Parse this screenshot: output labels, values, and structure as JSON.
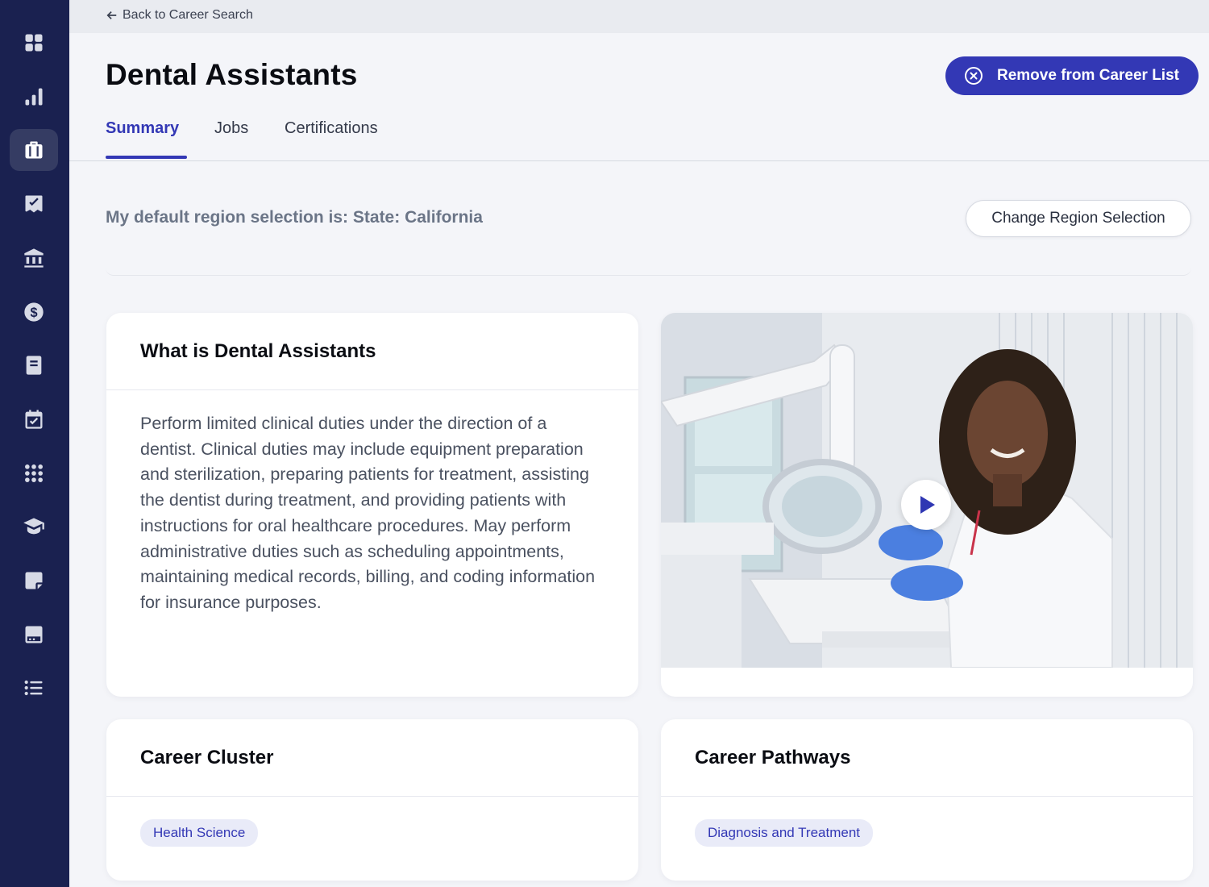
{
  "nav": {
    "back_label": "Back to Career Search",
    "sidebar_icons": [
      "dashboard-icon",
      "chart-icon",
      "briefcase-icon",
      "checklist-icon",
      "bank-icon",
      "dollar-icon",
      "book-icon",
      "calendar-check-icon",
      "apps-grid-icon",
      "graduation-cap-icon",
      "note-icon",
      "tray-icon",
      "list-icon"
    ],
    "active_icon": "briefcase-icon"
  },
  "header": {
    "title": "Dental Assistants",
    "remove_button_label": "Remove from Career List"
  },
  "tabs": [
    {
      "label": "Summary",
      "active": true
    },
    {
      "label": "Jobs",
      "active": false
    },
    {
      "label": "Certifications",
      "active": false
    }
  ],
  "region": {
    "text": "My default region selection is: State: California",
    "change_button_label": "Change Region Selection"
  },
  "what_is": {
    "title": "What is Dental Assistants",
    "description": "Perform limited clinical duties under the direction of a dentist. Clinical duties may include equipment preparation and sterilization, preparing patients for treatment, assisting the dentist during treatment, and providing patients with instructions for oral healthcare procedures. May perform administrative duties such as scheduling appointments, maintaining medical records, billing, and coding information for insurance purposes."
  },
  "career_cluster": {
    "title": "Career Cluster",
    "chip": "Health Science"
  },
  "career_pathways": {
    "title": "Career Pathways",
    "chip": "Diagnosis and Treatment"
  },
  "colors": {
    "sidebar_bg": "#1a2150",
    "accent": "#3338b5",
    "chip_bg": "#e9ebf8",
    "page_bg": "#f4f5f9"
  }
}
